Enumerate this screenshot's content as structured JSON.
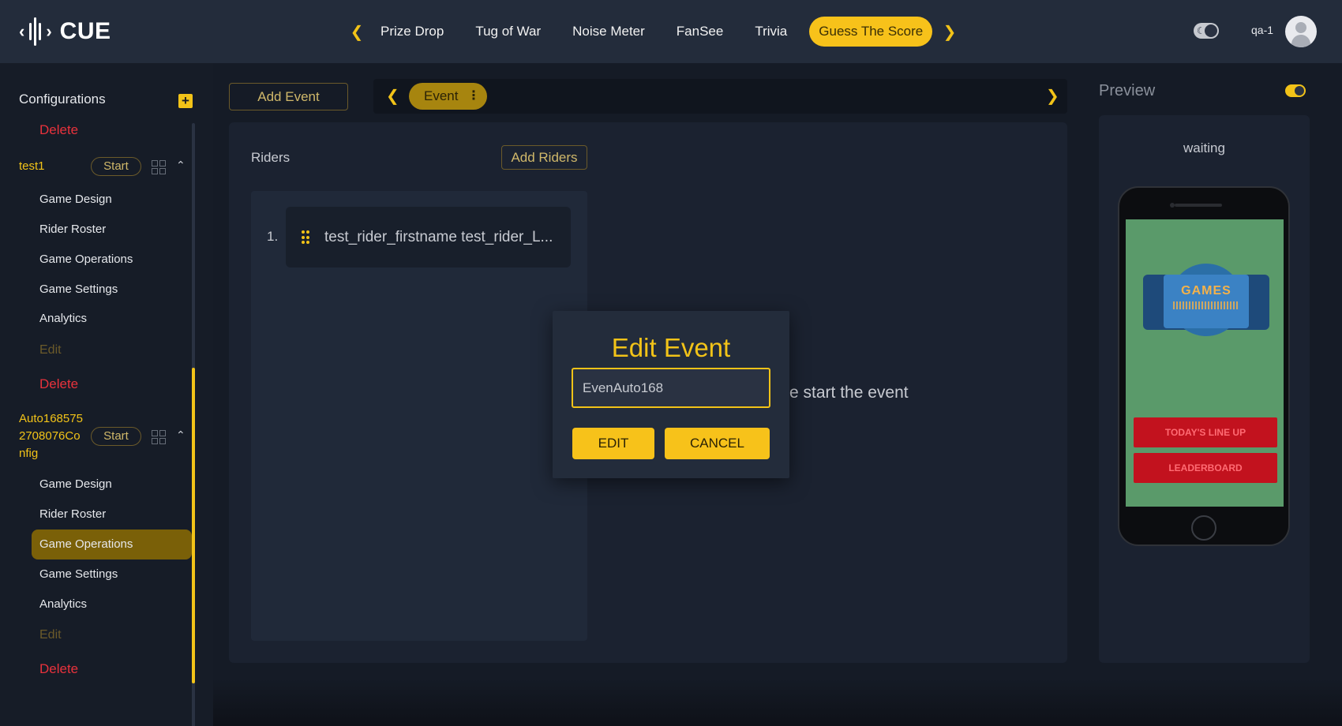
{
  "app": {
    "logo_text": "CUE"
  },
  "top_nav": {
    "games": [
      "Prize Drop",
      "Tug of War",
      "Noise Meter",
      "FanSee",
      "Trivia",
      "Guess The Score"
    ],
    "active_game": "Guess The Score",
    "user_name": "qa-1"
  },
  "sidebar": {
    "title": "Configurations",
    "top_delete": "Delete",
    "configs": [
      {
        "name": "test1",
        "start_label": "Start",
        "items": [
          "Game Design",
          "Rider Roster",
          "Game Operations",
          "Game Settings",
          "Analytics"
        ],
        "edit_label": "Edit",
        "delete_label": "Delete"
      },
      {
        "name_lines": [
          "Auto168575",
          "2708076Co",
          "nfig"
        ],
        "start_label": "Start",
        "items": [
          "Game Design",
          "Rider Roster",
          "Game Operations",
          "Game Settings",
          "Analytics"
        ],
        "active_item": "Game Operations",
        "edit_label": "Edit",
        "delete_label": "Delete"
      }
    ]
  },
  "main": {
    "add_event_label": "Add Event",
    "event_chip_label": "Event",
    "riders_label": "Riders",
    "add_riders_label": "Add Riders",
    "riders": [
      {
        "number": "1.",
        "name": "test_rider_firstname test_rider_L..."
      }
    ],
    "hint_text": "e start the event"
  },
  "preview": {
    "title": "Preview",
    "status": "waiting",
    "screen_buttons": [
      "Today's Line Up",
      "Leaderboard"
    ],
    "games_logo_text": "GAMES"
  },
  "modal": {
    "title": "Edit Event",
    "input_value": "EvenAuto168",
    "edit_label": "EDIT",
    "cancel_label": "CANCEL"
  }
}
